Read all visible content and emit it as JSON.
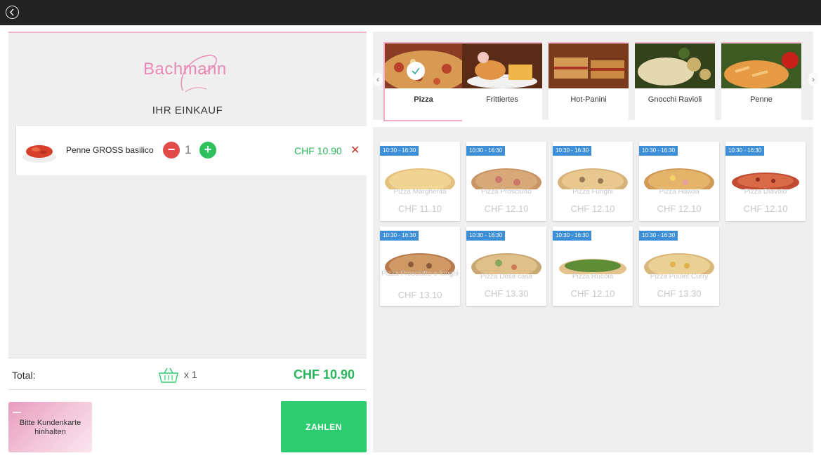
{
  "header": {
    "back_icon": "back-arrow-icon"
  },
  "brand": {
    "logo_text": "Bachmann",
    "color": "#e889b4"
  },
  "cart": {
    "title": "IHR EINKAUF",
    "items": [
      {
        "name": "Penne GROSS basilico",
        "quantity": "1",
        "price": "CHF 10.90"
      }
    ],
    "total_label": "Total:",
    "item_count": "x 1",
    "total_value": "CHF 10.90"
  },
  "card_prompt": "Bitte Kundenkarte hinhalten",
  "pay_button": "ZAHLEN",
  "categories": [
    {
      "label": "Pizza",
      "selected": true
    },
    {
      "label": "Frittiertes",
      "selected": false
    },
    {
      "label": "Hot-Panini",
      "selected": false
    },
    {
      "label": "Gnocchi Ravioli",
      "selected": false
    },
    {
      "label": "Penne",
      "selected": false
    }
  ],
  "products": [
    {
      "time": "10:30 - 16:30",
      "name": "Pizza Margherita",
      "price": "CHF 11.10"
    },
    {
      "time": "10:30 - 16:30",
      "name": "Pizza Prosciutto",
      "price": "CHF 12.10"
    },
    {
      "time": "10:30 - 16:30",
      "name": "Pizza Funghi",
      "price": "CHF 12.10"
    },
    {
      "time": "10:30 - 16:30",
      "name": "Pizza Hawaii",
      "price": "CHF 12.10"
    },
    {
      "time": "10:30 - 16:30",
      "name": "Pizza Diavolo",
      "price": "CHF 12.10"
    },
    {
      "time": "10:30 - 16:30",
      "name": "Pizza Prosciutto e funghi",
      "price": "CHF 13.10"
    },
    {
      "time": "10:30 - 16:30",
      "name": "Pizza Della casa",
      "price": "CHF 13.30"
    },
    {
      "time": "10:30 - 16:30",
      "name": "Pizza Rucola",
      "price": "CHF 12.10"
    },
    {
      "time": "10:30 - 16:30",
      "name": "Pizza Poulet Curry",
      "price": "CHF 13.30"
    }
  ],
  "colors": {
    "accent_green": "#2ecc71",
    "price_green": "#27b45a",
    "time_badge": "#3d8fd8",
    "remove_red": "#c0392b",
    "pink": "#f4b6cf"
  }
}
